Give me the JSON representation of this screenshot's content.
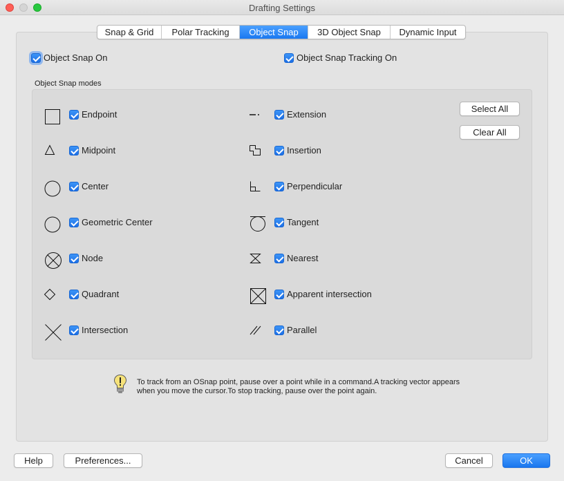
{
  "window": {
    "title": "Drafting Settings"
  },
  "tabs": [
    {
      "label": "Snap & Grid",
      "active": false
    },
    {
      "label": "Polar Tracking",
      "active": false
    },
    {
      "label": "Object Snap",
      "active": true
    },
    {
      "label": "3D Object Snap",
      "active": false
    },
    {
      "label": "Dynamic Input",
      "active": false
    }
  ],
  "options": {
    "snap_on": {
      "label": "Object Snap On",
      "checked": true
    },
    "tracking_on": {
      "label": "Object Snap Tracking On",
      "checked": true
    }
  },
  "modes": {
    "title": "Object Snap modes",
    "left": [
      {
        "label": "Endpoint",
        "icon": "endpoint-icon",
        "checked": true
      },
      {
        "label": "Midpoint",
        "icon": "midpoint-icon",
        "checked": true
      },
      {
        "label": "Center",
        "icon": "center-icon",
        "checked": true
      },
      {
        "label": "Geometric Center",
        "icon": "geometric-center-icon",
        "checked": true
      },
      {
        "label": "Node",
        "icon": "node-icon",
        "checked": true
      },
      {
        "label": "Quadrant",
        "icon": "quadrant-icon",
        "checked": true
      },
      {
        "label": "Intersection",
        "icon": "intersection-icon",
        "checked": true
      }
    ],
    "right": [
      {
        "label": "Extension",
        "icon": "extension-icon",
        "checked": true
      },
      {
        "label": "Insertion",
        "icon": "insertion-icon",
        "checked": true
      },
      {
        "label": "Perpendicular",
        "icon": "perpendicular-icon",
        "checked": true
      },
      {
        "label": "Tangent",
        "icon": "tangent-icon",
        "checked": true
      },
      {
        "label": "Nearest",
        "icon": "nearest-icon",
        "checked": true
      },
      {
        "label": "Apparent intersection",
        "icon": "apparent-intersection-icon",
        "checked": true
      },
      {
        "label": "Parallel",
        "icon": "parallel-icon",
        "checked": true
      }
    ],
    "select_all": "Select All",
    "clear_all": "Clear All"
  },
  "hint": {
    "icon": "lightbulb-icon",
    "text": "To track from an OSnap point, pause over a point while in a command.A tracking vector appears when you move the cursor.To stop tracking, pause over the point again."
  },
  "footer": {
    "help": "Help",
    "preferences": "Preferences...",
    "cancel": "Cancel",
    "ok": "OK"
  },
  "colors": {
    "accent": "#1a78f0"
  }
}
